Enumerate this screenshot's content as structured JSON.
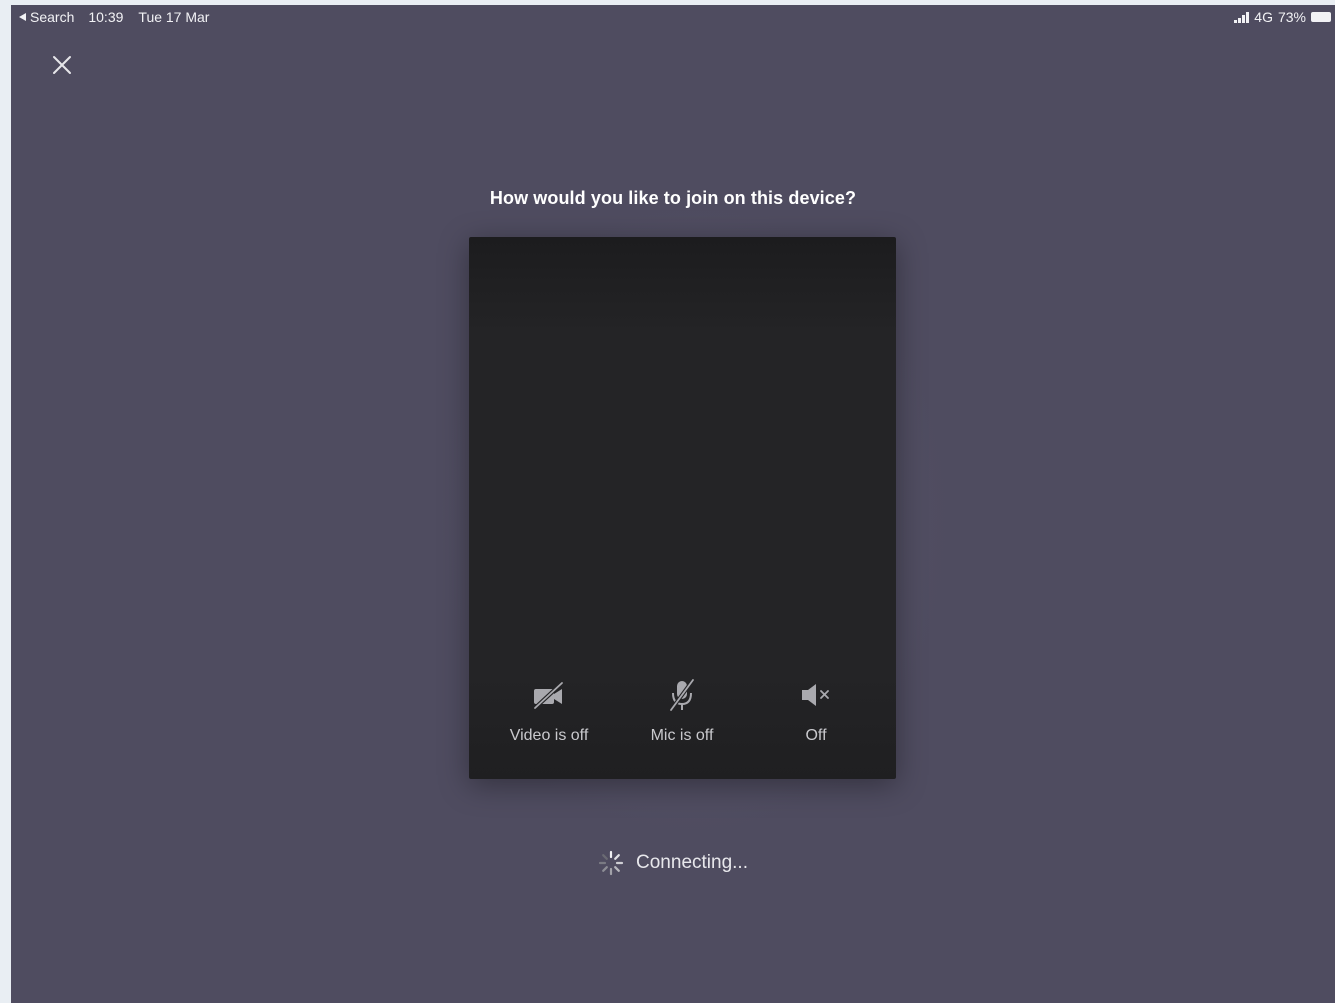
{
  "status_bar": {
    "back_app": "Search",
    "time": "10:39",
    "date": "Tue 17 Mar",
    "network": "4G",
    "battery": "73%"
  },
  "prompt": "How would you like to join on this device?",
  "controls": {
    "video": {
      "label": "Video is off",
      "icon": "video-off-icon"
    },
    "mic": {
      "label": "Mic is off",
      "icon": "mic-off-icon"
    },
    "speaker": {
      "label": "Off",
      "icon": "speaker-off-icon"
    }
  },
  "status": {
    "text": "Connecting...",
    "icon": "spinner-icon"
  },
  "colors": {
    "background": "#4f4c60",
    "preview": "#242426",
    "control_text": "#c9c9cd"
  }
}
